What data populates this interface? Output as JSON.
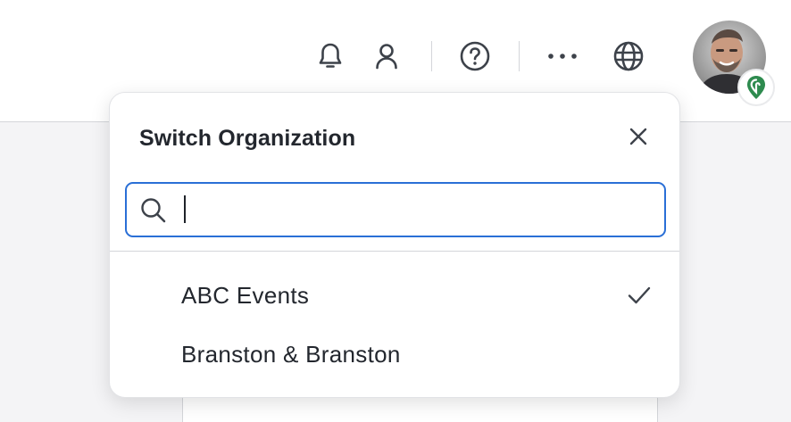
{
  "header": {
    "icons": [
      "bell-icon",
      "user-icon",
      "help-icon",
      "more-icon",
      "globe-icon"
    ],
    "avatar_badge_color": "#2e8b4f"
  },
  "popover": {
    "title": "Switch Organization",
    "search": {
      "value": "",
      "placeholder": ""
    },
    "organizations": [
      {
        "name": "ABC Events",
        "selected": true
      },
      {
        "name": "Branston & Branston",
        "selected": false
      }
    ]
  },
  "colors": {
    "accent": "#2a6fd6",
    "text": "#23272e",
    "icon": "#3d424a"
  }
}
